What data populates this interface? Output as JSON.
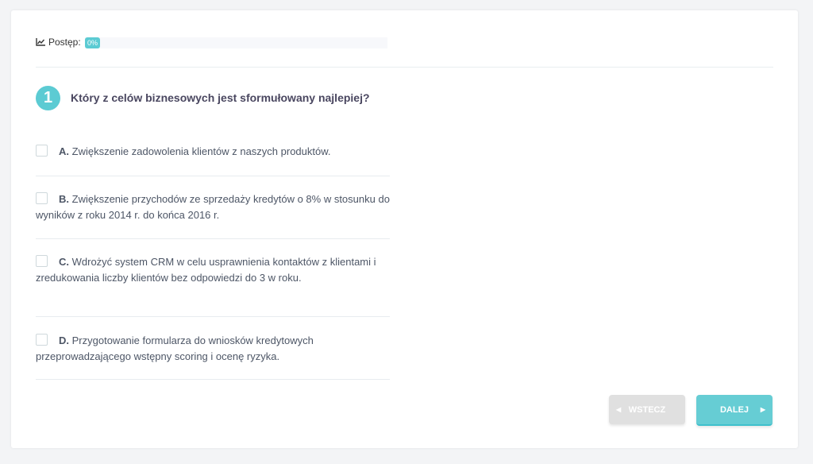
{
  "progress": {
    "label": "Postęp:",
    "value_label": "0%",
    "value": 0
  },
  "question": {
    "number": "1",
    "text": "Który z celów biznesowych jest sformułowany najlepiej?"
  },
  "options": [
    {
      "letter": "A.",
      "text": "Zwiększenie zadowolenia klientów z naszych produktów."
    },
    {
      "letter": "B.",
      "text": "Zwiększenie przychodów ze sprzedaży kredytów o 8% w stosunku do wyników z roku 2014 r. do końca 2016 r."
    },
    {
      "letter": "C.",
      "text": "Wdrożyć system CRM w celu usprawnienia kontaktów z klientami i zredukowania liczby klientów bez odpowiedzi do 3 w roku."
    },
    {
      "letter": "D.",
      "text": "Przygotowanie formularza do wniosków kredytowych przeprowadzającego wstępny scoring i ocenę ryzyka."
    }
  ],
  "buttons": {
    "back": "WSTECZ",
    "next": "DALEJ"
  }
}
